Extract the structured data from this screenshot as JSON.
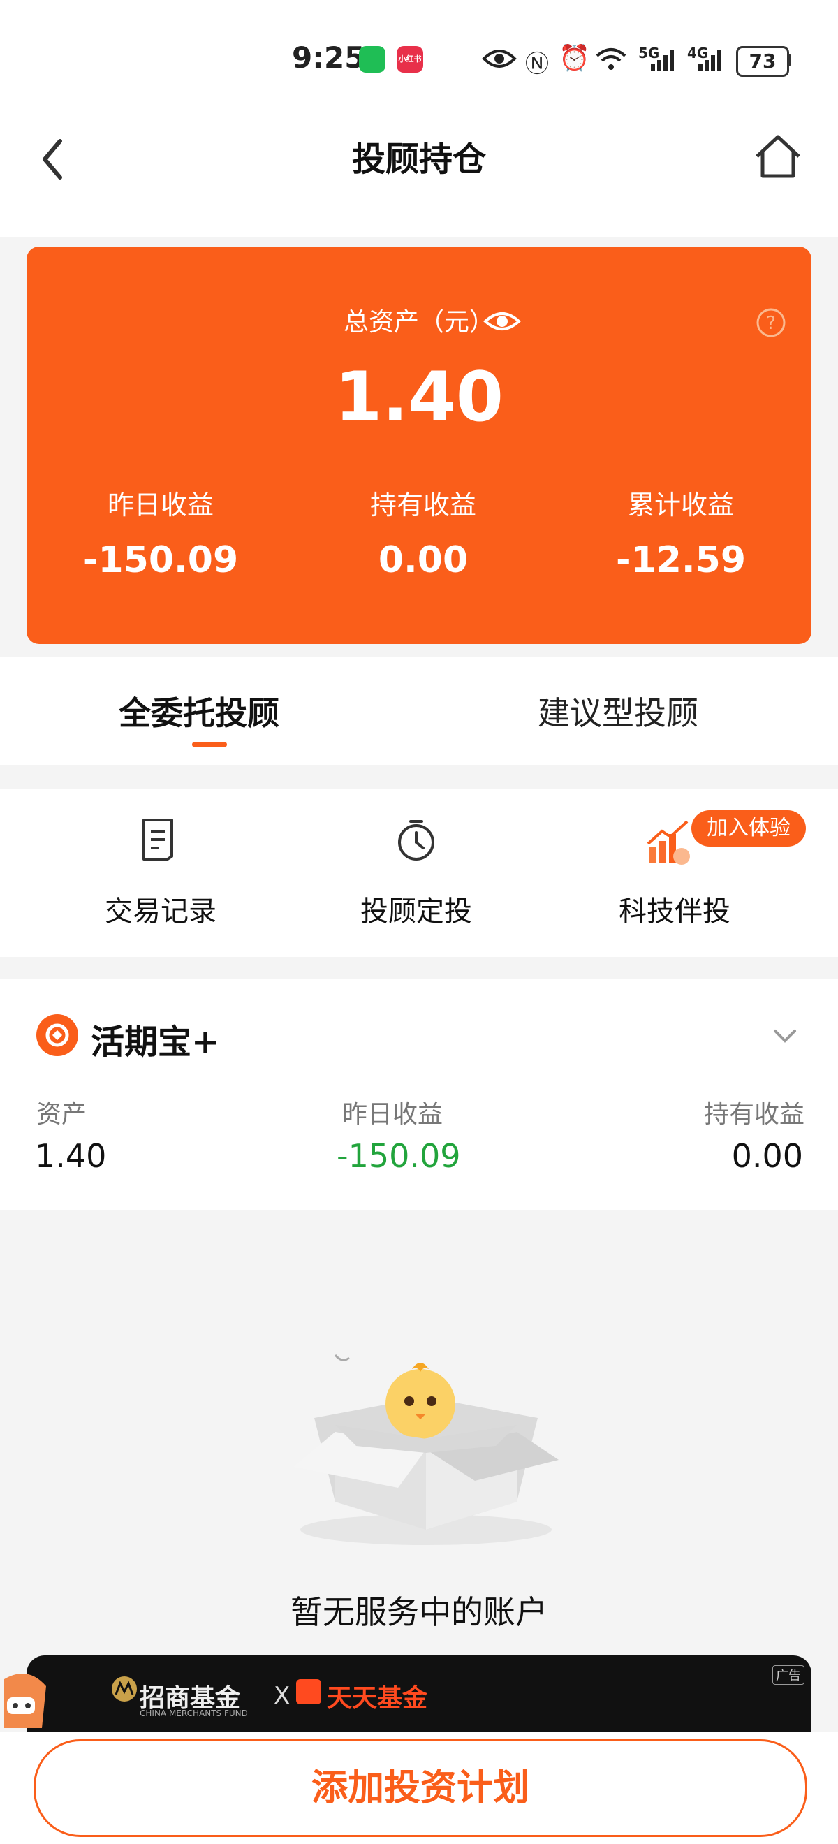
{
  "status_bar": {
    "time": "9:25",
    "wechat_badge": "",
    "xhs_badge": "小红书",
    "net1": "5G",
    "net2": "4G",
    "battery": "73"
  },
  "header": {
    "title": "投顾持仓"
  },
  "assets": {
    "label": "总资产（元）",
    "total": "1.40",
    "stats": [
      {
        "label": "昨日收益",
        "value": "-150.09"
      },
      {
        "label": "持有收益",
        "value": "0.00"
      },
      {
        "label": "累计收益",
        "value": "-12.59"
      }
    ]
  },
  "tabs": [
    {
      "label": "全委托投顾",
      "active": true
    },
    {
      "label": "建议型投顾",
      "active": false
    }
  ],
  "shortcuts": [
    {
      "label": "交易记录",
      "icon": "document-icon"
    },
    {
      "label": "投顾定投",
      "icon": "timer-icon"
    },
    {
      "label": "科技伴投",
      "icon": "growth-chart-icon",
      "badge": "加入体验"
    }
  ],
  "product": {
    "name": "活期宝+",
    "columns": [
      {
        "label": "资产",
        "value": "1.40"
      },
      {
        "label": "昨日收益",
        "value": "-150.09"
      },
      {
        "label": "持有收益",
        "value": "0.00"
      }
    ]
  },
  "empty_state": {
    "text": "暂无服务中的账户"
  },
  "ad": {
    "brand": "招商基金",
    "sub": "CHINA MERCHANTS FUND",
    "x": "X",
    "partner": "天天基金",
    "tag": "广告"
  },
  "cta": {
    "label": "添加投资计划"
  },
  "colors": {
    "accent": "#fa5e1a",
    "negative": "#22a43c"
  }
}
